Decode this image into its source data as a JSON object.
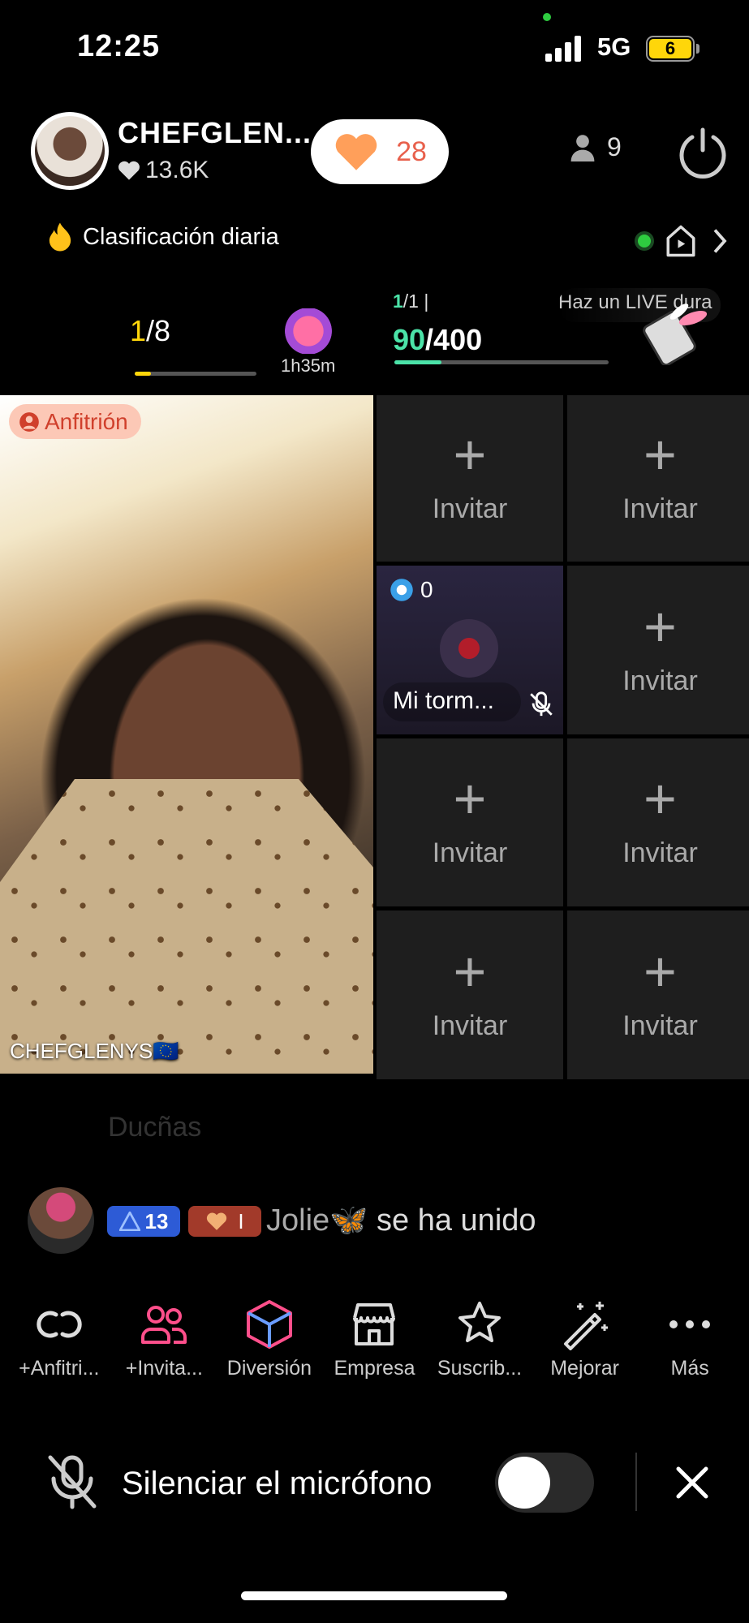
{
  "status_bar": {
    "time": "12:25",
    "network": "5G",
    "battery": "6"
  },
  "host": {
    "name": "CHEFGLEN...",
    "likes": "13.6K",
    "hearts": "28",
    "viewers": "9"
  },
  "ranking": {
    "label": "Clasificación diaria"
  },
  "progress": {
    "rank_current": "1",
    "rank_total": "/8",
    "gift_timer": "1h35m",
    "level_current": "1",
    "level_total": "/1",
    "level_separator": "|",
    "points_current": "90",
    "points_total": "/400",
    "live_hint": "Haz un LIVE dura"
  },
  "video": {
    "host_badge": "Anfitrión",
    "host_cam_name": "CHEFGLENYS🇪🇺"
  },
  "guest_grid": {
    "invite_label": "Invitar",
    "plus": "+",
    "guest": {
      "count": "0",
      "name": "Mi torm..."
    }
  },
  "chat": {
    "faded_text": "Ducñas",
    "badge_level": "13",
    "badge_fan": "I",
    "user": "Jolie🦋",
    "message": "se ha unido"
  },
  "toolbar": [
    {
      "label": "+Anfitri...",
      "icon": "link-icon"
    },
    {
      "label": "+Invita...",
      "icon": "users-icon"
    },
    {
      "label": "Diversión",
      "icon": "cube-icon"
    },
    {
      "label": "Empresa",
      "icon": "shop-icon"
    },
    {
      "label": "Suscrib...",
      "icon": "star-icon"
    },
    {
      "label": "Mejorar",
      "icon": "magic-wand-icon"
    },
    {
      "label": "Más",
      "icon": "more-icon"
    }
  ],
  "bottom": {
    "mute_label": "Silenciar el micrófono"
  },
  "colors": {
    "accent_yellow": "#ffd60a",
    "accent_green": "#4be3a8",
    "heart": "#e8604c",
    "host_badge_bg": "#fcc8b6"
  }
}
